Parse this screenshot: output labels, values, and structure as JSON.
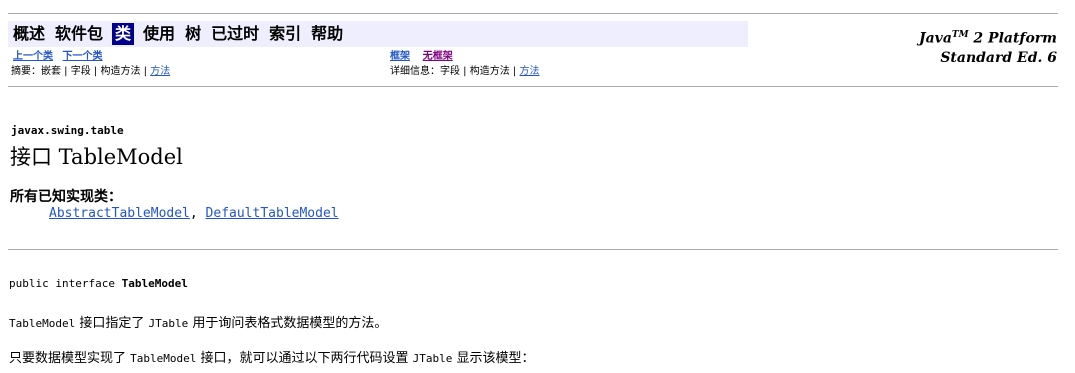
{
  "nav": {
    "items": [
      "概述",
      "软件包",
      "类",
      "使用",
      "树",
      "已过时",
      "索引",
      "帮助"
    ],
    "active_index": 2
  },
  "platform": {
    "line1_a": "Java",
    "line1_tm": "TM",
    "line1_b": " 2 Platform",
    "line2": "Standard Ed. 6"
  },
  "subnav": {
    "prev_class": "上一个类",
    "next_class": "下一个类",
    "frames": "框架",
    "no_frames": "无框架",
    "summary_label": "摘要：",
    "summary_nested": "嵌套",
    "summary_field": "字段",
    "summary_constr": "构造方法",
    "summary_method": "方法",
    "detail_label": "详细信息：",
    "detail_field": "字段",
    "detail_constr": "构造方法",
    "detail_method": "方法",
    "sep": " | "
  },
  "header": {
    "package": "javax.swing.table",
    "title": "接口 TableModel"
  },
  "implementing": {
    "label": "所有已知实现类：",
    "class1": "AbstractTableModel",
    "sep": ", ",
    "class2": "DefaultTableModel"
  },
  "declaration": {
    "prefix": "public interface ",
    "name": "TableModel"
  },
  "description": {
    "p1_code1": "TableModel",
    "p1_text1": " 接口指定了 ",
    "p1_code2": "JTable",
    "p1_text2": " 用于询问表格式数据模型的方法。",
    "p2_text1": "只要数据模型实现了 ",
    "p2_code1": "TableModel",
    "p2_text2": " 接口，就可以通过以下两行代码设置 ",
    "p2_code2": "JTable",
    "p2_text3": " 显示该模型："
  }
}
